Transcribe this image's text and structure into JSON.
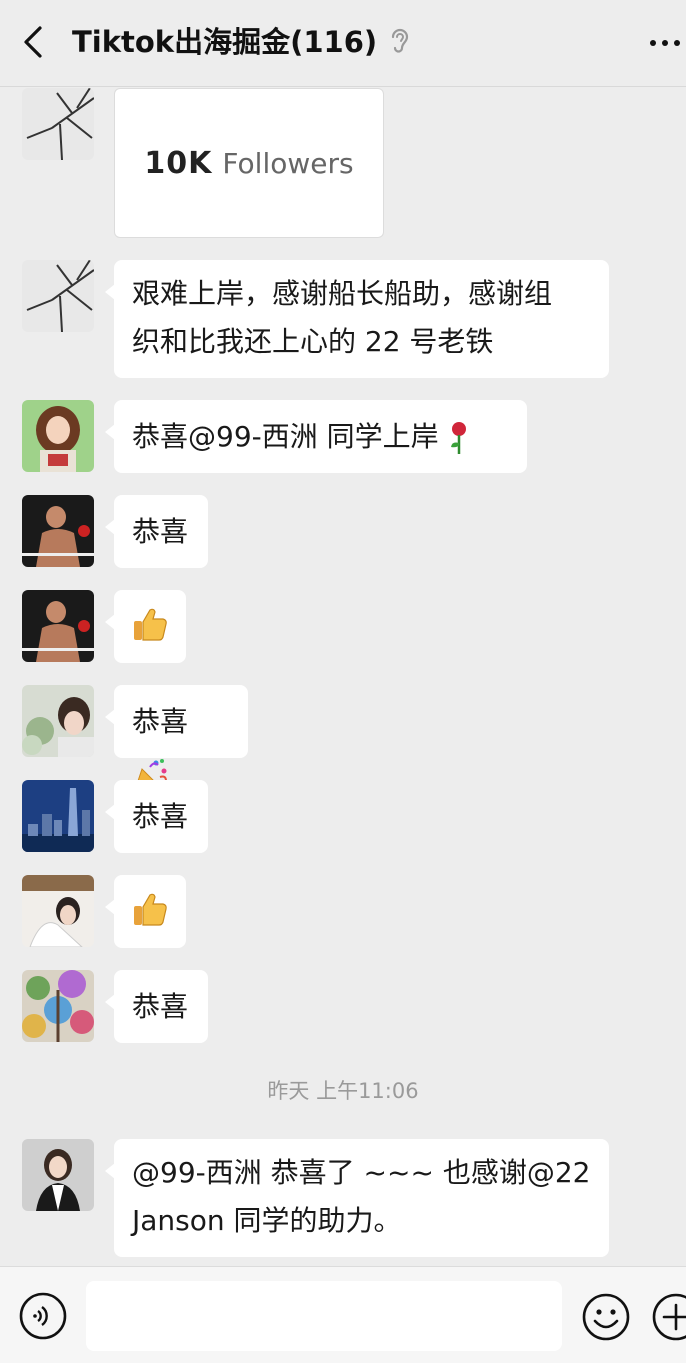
{
  "header": {
    "title": "Tiktok出海掘金(116)"
  },
  "messages": [
    {
      "type": "image",
      "image_text_bold": "10K",
      "image_text": "Followers"
    },
    {
      "type": "text",
      "line1": "艰难上岸，感谢船长船助，感谢组",
      "line2": "织和比我还上心的 22 号老铁"
    },
    {
      "type": "text",
      "text": "恭喜@99-西洲 同学上岸",
      "emoji": "rose-icon"
    },
    {
      "type": "text",
      "text": "恭喜"
    },
    {
      "type": "emoji",
      "emoji": "thumbs-up-icon"
    },
    {
      "type": "text",
      "text": "恭喜",
      "emoji": "party-popper-icon"
    },
    {
      "type": "text",
      "text": "恭喜"
    },
    {
      "type": "emoji",
      "emoji": "thumbs-up-icon"
    },
    {
      "type": "text",
      "text": "恭喜"
    },
    {
      "type": "text",
      "line1": "@99-西洲 恭喜了 ~~~ 也感谢@22",
      "line2": "Janson 同学的助力。"
    }
  ],
  "timestamp": "昨天 上午11:06",
  "footer": {
    "voice": "voice-icon",
    "emoji": "emoji-face-icon",
    "plus": "plus-icon"
  },
  "colors": {
    "background": "#ededed",
    "bubble": "#ffffff",
    "text": "#191919",
    "timestamp": "#9a9a9a"
  }
}
